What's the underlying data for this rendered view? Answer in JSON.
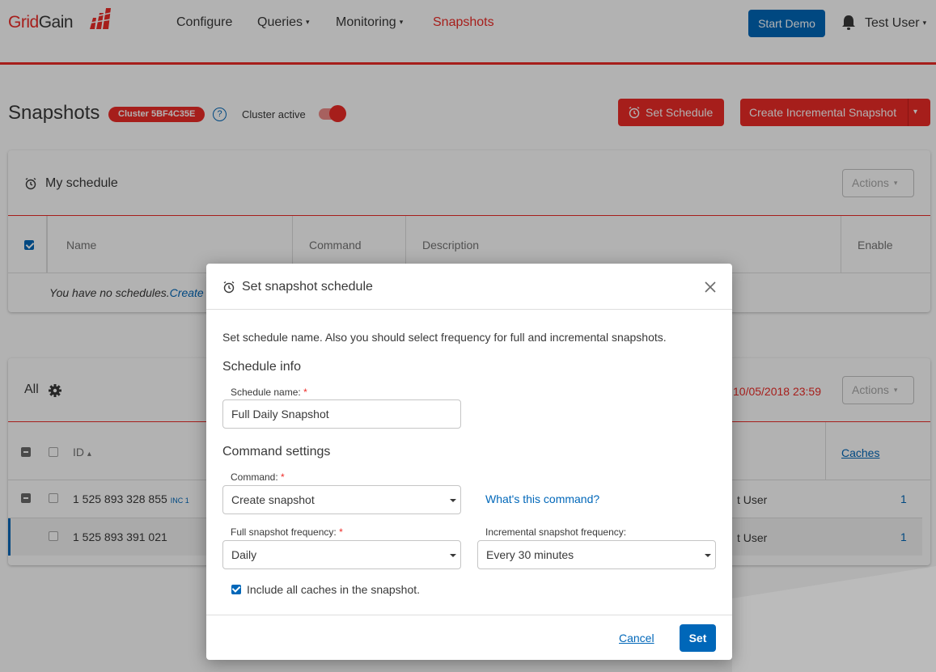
{
  "header": {
    "logo_text_1": "Grid",
    "logo_text_2": "Gain",
    "nav": [
      {
        "label": "Configure",
        "has_caret": false
      },
      {
        "label": "Queries",
        "has_caret": true
      },
      {
        "label": "Monitoring",
        "has_caret": true
      },
      {
        "label": "Snapshots",
        "has_caret": false,
        "active": true
      }
    ],
    "start_demo": "Start Demo",
    "user": "Test User",
    "icons": {
      "bell": "bell-icon",
      "caret": "▾"
    }
  },
  "page": {
    "title": "Snapshots",
    "cluster_badge": "Cluster 5BF4C35E",
    "help": "?",
    "cluster_active_label": "Cluster active",
    "cluster_active": true,
    "set_schedule": "Set Schedule",
    "create_incremental": "Create Incremental Snapshot"
  },
  "schedule_panel": {
    "title": "My schedule",
    "actions": "Actions",
    "columns": [
      "Name",
      "Command",
      "Description",
      "Enable"
    ],
    "empty_text": "You have no schedules.",
    "empty_link": "Create or"
  },
  "all_panel": {
    "title": "All",
    "date": "10/05/2018  23:59",
    "actions": "Actions",
    "id_header": "ID",
    "sort_icon": "▴",
    "caches_header": "Caches",
    "rows": [
      {
        "id": "1 525 893 328 855",
        "tag": "INC 1",
        "user": "t User",
        "caches": "1"
      },
      {
        "id": "1 525 893 391 021",
        "tag": "",
        "user": "t User",
        "caches": "1"
      }
    ]
  },
  "modal": {
    "title": "Set snapshot schedule",
    "description": "Set schedule name. Also you should select frequency for full and incremental snapshots.",
    "schedule_info": "Schedule info",
    "schedule_name_label": "Schedule name:",
    "schedule_name_value": "Full Daily Snapshot",
    "command_settings": "Command settings",
    "command_label": "Command:",
    "command_value": "Create snapshot",
    "whats_this": "What's this command?",
    "full_freq_label": "Full snapshot frequency:",
    "full_freq_value": "Daily",
    "inc_freq_label": "Incremental snapshot frequency:",
    "inc_freq_value": "Every 30 minutes",
    "include_caches": "Include all caches in the snapshot.",
    "include_caches_checked": true,
    "required_mark": "*",
    "cancel": "Cancel",
    "set": "Set"
  },
  "colors": {
    "brand_red": "#ee2b27",
    "brand_blue": "#0067b9"
  }
}
